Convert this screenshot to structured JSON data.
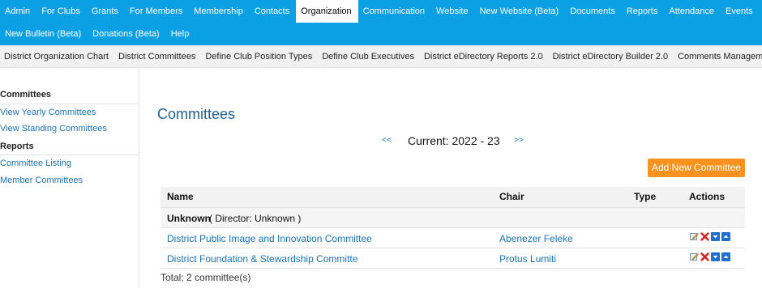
{
  "top_nav": {
    "row1": [
      "Admin",
      "For Clubs",
      "Grants",
      "For Members",
      "Membership",
      "Contacts",
      "Organization",
      "Communication",
      "Website",
      "New Website (Beta)",
      "Documents",
      "Reports",
      "Attendance",
      "Events"
    ],
    "row2": [
      "New Bulletin (Beta)",
      "Donations (Beta)",
      "Help"
    ],
    "active": "Organization"
  },
  "sub_nav": [
    "District Organization Chart",
    "District Committees",
    "Define Club Position Types",
    "Define Club Executives",
    "District eDirectory Reports 2.0",
    "District eDirectory Builder 2.0",
    "Comments Management"
  ],
  "sidebar": {
    "committees_heading": "Committees",
    "view_yearly": "View Yearly Committees",
    "view_standing": "View Standing Committees",
    "reports_heading": "Reports",
    "committee_listing": "Committee Listing",
    "member_committees": "Member Committees"
  },
  "main": {
    "title": "Committees",
    "prev": "<<",
    "current": "Current: 2022 - 23",
    "next": ">>",
    "add_button": "Add New Committee"
  },
  "table": {
    "headers": {
      "name": "Name",
      "chair": "Chair",
      "type": "Type",
      "actions": "Actions"
    },
    "group": {
      "name": "Unknown",
      "director": "( Director: Unknown )"
    },
    "rows": [
      {
        "name": "District Public Image and Innovation Committee",
        "chair": "Abenezer Feleke",
        "type": ""
      },
      {
        "name": "District Foundation & Stewardship Committe",
        "chair": "Protus Lumiti",
        "type": ""
      }
    ],
    "total": "Total: 2 committee(s)"
  },
  "colors": {
    "nav_blue": "#0b9fe4",
    "link_blue": "#1a73b5",
    "title_blue": "#1f5f8f",
    "button_orange": "#f7931e"
  },
  "icons": [
    "edit-icon",
    "delete-icon",
    "move-down-icon",
    "move-up-icon"
  ]
}
